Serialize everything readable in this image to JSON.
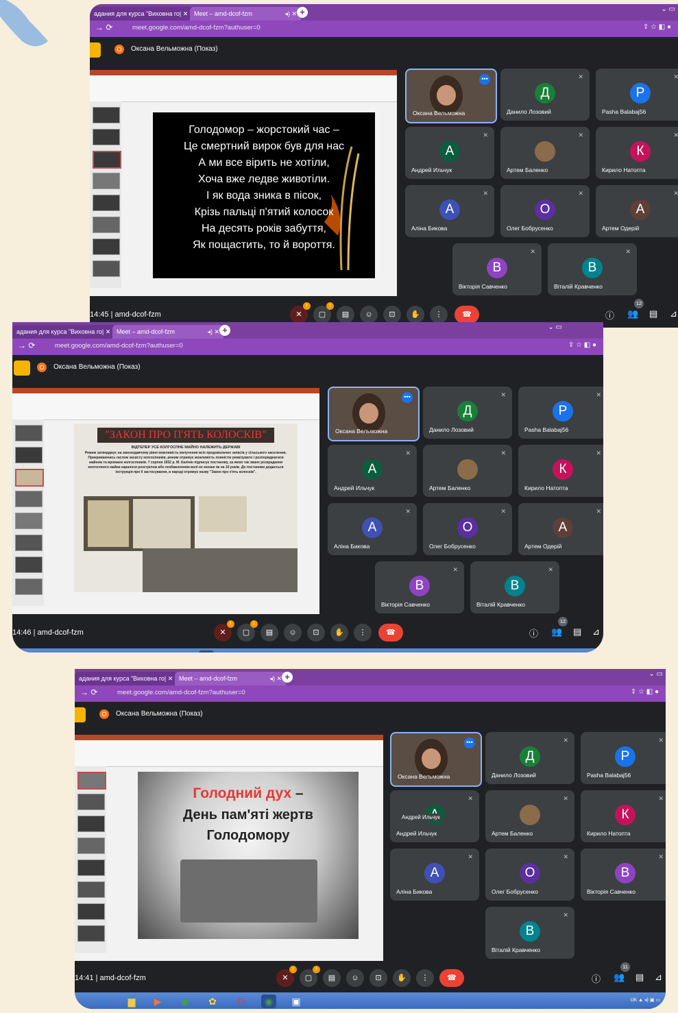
{
  "browser": {
    "tab1_title": "адания для курса \"Виховна го| ✕",
    "tab2_title": "Meet – amd-dcof-fzm",
    "url": "meet.google.com/amd-dcof-fzm?authuser=0"
  },
  "meeting": {
    "presenter_banner": "Оксана Вельможна (Показ)",
    "presenter_initial": "О",
    "code": "amd-dcof-fzm",
    "self_name": "Оксана Вельможна"
  },
  "participants": [
    {
      "initial": "Д",
      "name": "Данило Лозовий",
      "color": "#188038"
    },
    {
      "initial": "P",
      "name": "Pasha Balabaj56",
      "color": "#1a73e8"
    },
    {
      "initial": "А",
      "name": "Андрей Ильчук",
      "color": "#0b5d40"
    },
    {
      "initial": "",
      "name": "Артем Баленко",
      "color": "#8b6b4a"
    },
    {
      "initial": "К",
      "name": "Кирило Натопта",
      "color": "#c5135b"
    },
    {
      "initial": "А",
      "name": "Аліна Бикова",
      "color": "#3f51b5"
    },
    {
      "initial": "О",
      "name": "Олег Бобрусенко",
      "color": "#5b2fa0"
    },
    {
      "initial": "А",
      "name": "Артем Одерій",
      "color": "#5d4037"
    },
    {
      "initial": "В",
      "name": "Вікторія Савченко",
      "color": "#8e44c2"
    },
    {
      "initial": "В",
      "name": "Віталій Кравченко",
      "color": "#00838f"
    }
  ],
  "shots": [
    {
      "time": "14:45",
      "count": "12"
    },
    {
      "time": "14:46",
      "count": "12"
    },
    {
      "time": "14:41",
      "count": "11"
    }
  ],
  "slide1": {
    "lines": [
      "Голодомор – жорстокий час –",
      "Це смертний вирок був для нас",
      "А ми все вірить не хотіли,",
      "Хоча вже ледве животіли.",
      "І як вода зника в пісок,",
      "Крізь пальці п'ятий колосок",
      "На десять років забуття,",
      "Як пощастить, то й вороття."
    ]
  },
  "slide2": {
    "title": "\"ЗАКОН ПРО П'ЯТЬ КОЛОСКІВ\"",
    "heading": "ВІДТЕПЕР УСЕ КОЛГОСПНЕ МАЙНО НАЛЕЖИТЬ ДЕРЖАВІ",
    "body": "Режим затверджує на законодавчому рівні можливість вилучення всіх продовольчих запасів у сільського населення. Прикриваючись гаслом захисту колгоспників, режим отримує можливість повністю реквізувати і розпоряджатися майном та врожаєм колгоспників. 7 серпня 1932 р. М. Калінін підписує постанову, за якою так зване розкрадання колгоспного майна каралося розстрілом або позбавленням волі не менше як на 10 років. До постанови додається інструкція про її застосування, в народі отримує назву \"Закон про п'ять колосків\"."
  },
  "slide3": {
    "red": "Голодний дух",
    "dash": " –",
    "line2": "День пам'яті жертв",
    "line3": "Голодомору"
  },
  "hover_label": "Андрей Ильчук",
  "tray_lang": "UK"
}
